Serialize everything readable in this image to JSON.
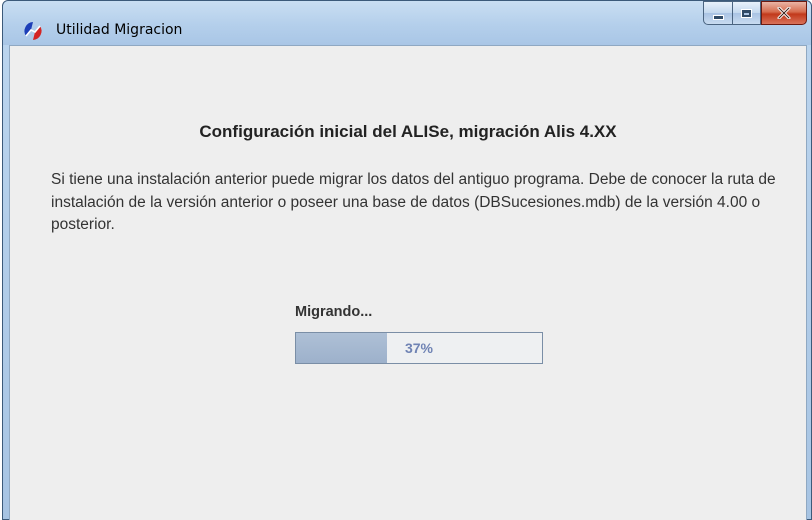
{
  "window": {
    "title": "Utilidad Migracion",
    "icon": "app-logo-icon",
    "controls": [
      "minimize-icon",
      "maximize-icon",
      "close-icon"
    ]
  },
  "content": {
    "heading": "Configuración inicial del ALISe, migración Alis 4.XX",
    "description": "Si tiene una instalación anterior puede migrar los datos del antiguo programa. Debe de conocer la ruta de instalación de la versión anterior o poseer una base de datos (DBSucesiones.mdb) de la versión 4.00 o posterior.",
    "progress": {
      "label": "Migrando...",
      "value_percent": 37,
      "text": "37%"
    }
  },
  "colors": {
    "accent": "#6f83b4",
    "fill": "#9db1cb"
  }
}
